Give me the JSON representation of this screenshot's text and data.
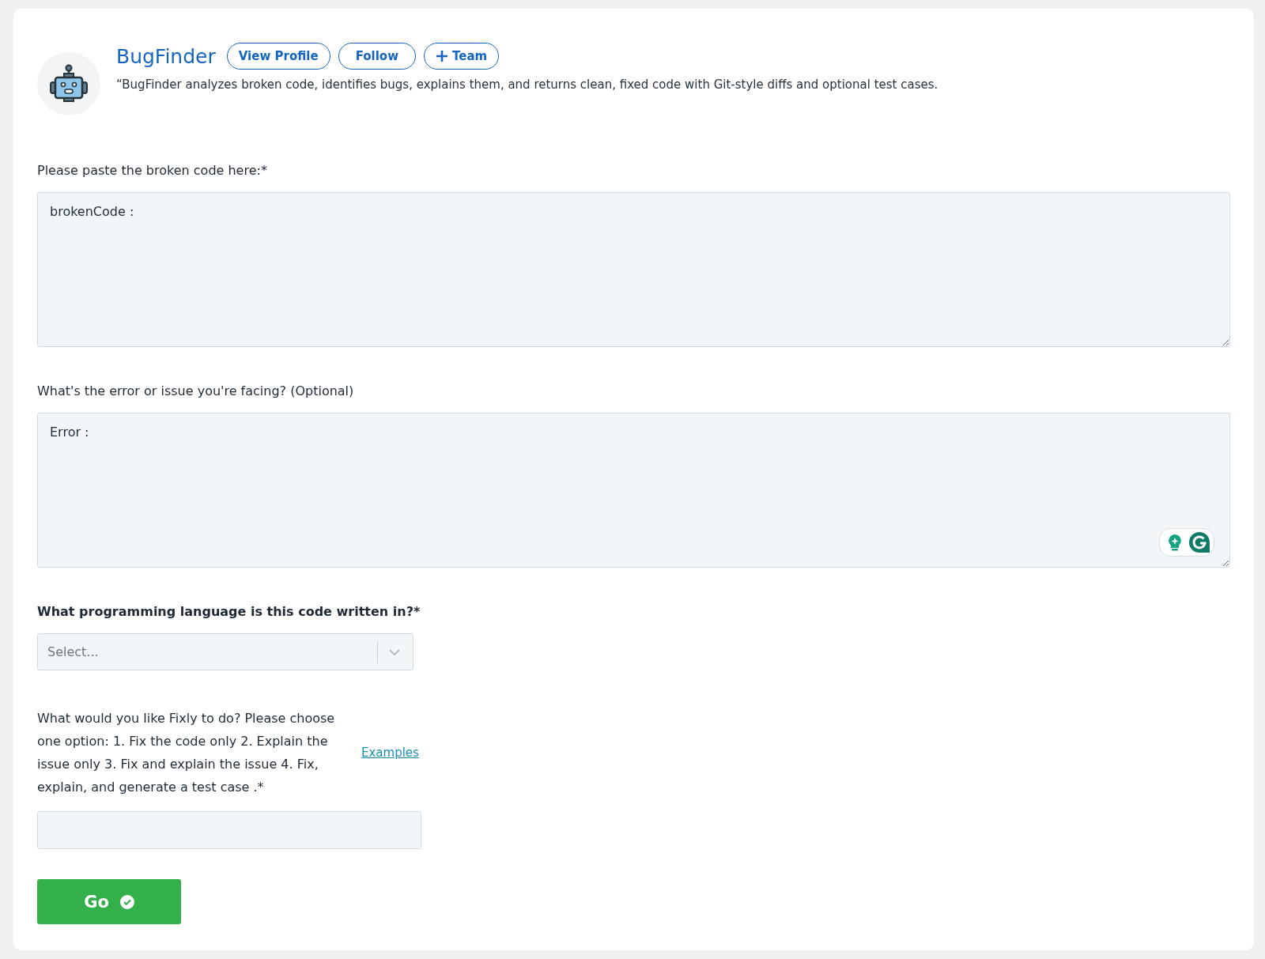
{
  "header": {
    "name": "BugFinder",
    "buttons": [
      {
        "label": "View Profile",
        "kind": "plain"
      },
      {
        "label": "Follow",
        "kind": "plain"
      },
      {
        "label": "Team",
        "kind": "add"
      }
    ],
    "description": "“BugFinder analyzes broken code, identifies bugs, explains them, and returns clean, fixed code with Git-style diffs and optional test cases."
  },
  "fields": [
    {
      "kind": "textarea",
      "label": "Please paste the broken code here:*",
      "value": "brokenCode :",
      "grammar_widget": false
    },
    {
      "kind": "textarea",
      "label": "What's the error or issue you're facing? (Optional)",
      "value": "Error :",
      "grammar_widget": true
    },
    {
      "kind": "select",
      "label": "What programming language is this code written in?*",
      "placeholder": "Select..."
    },
    {
      "kind": "text",
      "label": "What would you like Fixly to do? Please choose one option: 1. Fix the code only 2. Explain the issue only 3. Fix and explain the issue 4. Fix, explain, and generate a test case .*",
      "link": "Examples"
    }
  ],
  "submit": {
    "label": "Go"
  }
}
